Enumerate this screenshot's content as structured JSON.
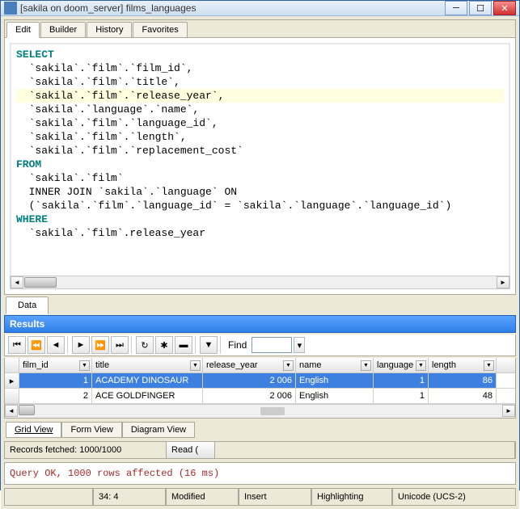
{
  "window": {
    "title": "[sakila on doom_server] films_languages"
  },
  "tabs": {
    "edit": "Edit",
    "builder": "Builder",
    "history": "History",
    "favorites": "Favorites"
  },
  "sql": {
    "l1": "SELECT",
    "l2": "  `sakila`.`film`.`film_id`,",
    "l3": "  `sakila`.`film`.`title`,",
    "l4": "  `sakila`.`film`.`release_year`,",
    "l5": "  `sakila`.`language`.`name`,",
    "l6": "  `sakila`.`film`.`language_id`,",
    "l7": "  `sakila`.`film`.`length`,",
    "l8": "  `sakila`.`film`.`replacement_cost`",
    "l9": "FROM",
    "l10": "  `sakila`.`film`",
    "l11": "  INNER JOIN `sakila`.`language` ON",
    "l12": "  (`sakila`.`film`.`language_id` = `sakila`.`language`.`language_id`)",
    "l13": "WHERE",
    "l14": "  `sakila`.`film`.release_year"
  },
  "data_tab": "Data",
  "results_label": "Results",
  "find_label": "Find",
  "columns": {
    "film_id": "film_id",
    "title": "title",
    "release_year": "release_year",
    "name": "name",
    "language": "language",
    "length": "length"
  },
  "rows": [
    {
      "film_id": "1",
      "title": "ACADEMY DINOSAUR",
      "release_year": "2 006",
      "name": "English",
      "language": "1",
      "length": "86"
    },
    {
      "film_id": "2",
      "title": "ACE GOLDFINGER",
      "release_year": "2 006",
      "name": "English",
      "language": "1",
      "length": "48"
    }
  ],
  "views": {
    "grid": "Grid View",
    "form": "Form View",
    "diagram": "Diagram View"
  },
  "records": {
    "fetched": "Records fetched: 1000/1000",
    "read": "Read ("
  },
  "query_msg": "Query OK, 1000 rows affected (16 ms)",
  "statusbar": {
    "pos": "34:  4",
    "modified": "Modified",
    "insert": "Insert",
    "highlighting": "Highlighting",
    "encoding": "Unicode (UCS-2)"
  }
}
